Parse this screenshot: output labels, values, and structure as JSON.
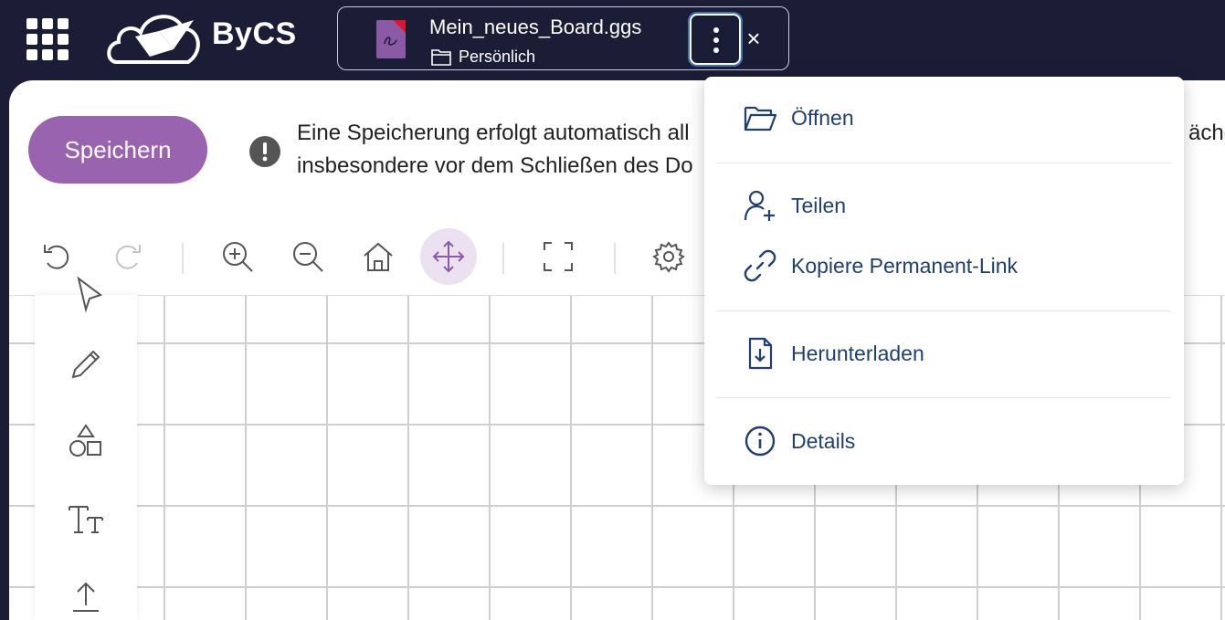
{
  "topbar": {
    "logo_text": "ByCS",
    "file": {
      "name": "Mein_neues_Board.ggs",
      "location": "Persönlich",
      "close_symbol": "×"
    }
  },
  "notice": {
    "save_label": "Speichern",
    "line1": "Eine Speicherung erfolgt automatisch all",
    "line1_tail": "äche",
    "line2": "insbesondere vor dem Schließen des Do"
  },
  "toolbar": {
    "icons": [
      "undo-icon",
      "redo-icon",
      "zoom-in-icon",
      "zoom-out-icon",
      "home-icon",
      "move-icon",
      "fullscreen-icon",
      "settings-icon"
    ]
  },
  "side_tools": {
    "icons": [
      "select-icon",
      "pen-icon",
      "shapes-icon",
      "text-icon",
      "upload-icon"
    ]
  },
  "menu": {
    "items": [
      {
        "label": "Öffnen",
        "icon": "folder-open-icon"
      },
      {
        "label": "Teilen",
        "icon": "add-user-icon"
      },
      {
        "label": "Kopiere Permanent-Link",
        "icon": "link-icon"
      },
      {
        "label": "Herunterladen",
        "icon": "download-icon"
      },
      {
        "label": "Details",
        "icon": "info-icon"
      }
    ]
  },
  "colors": {
    "accent": "#9a63b0",
    "topbar_bg": "#1b1d36",
    "menu_text": "#1f3f70"
  }
}
